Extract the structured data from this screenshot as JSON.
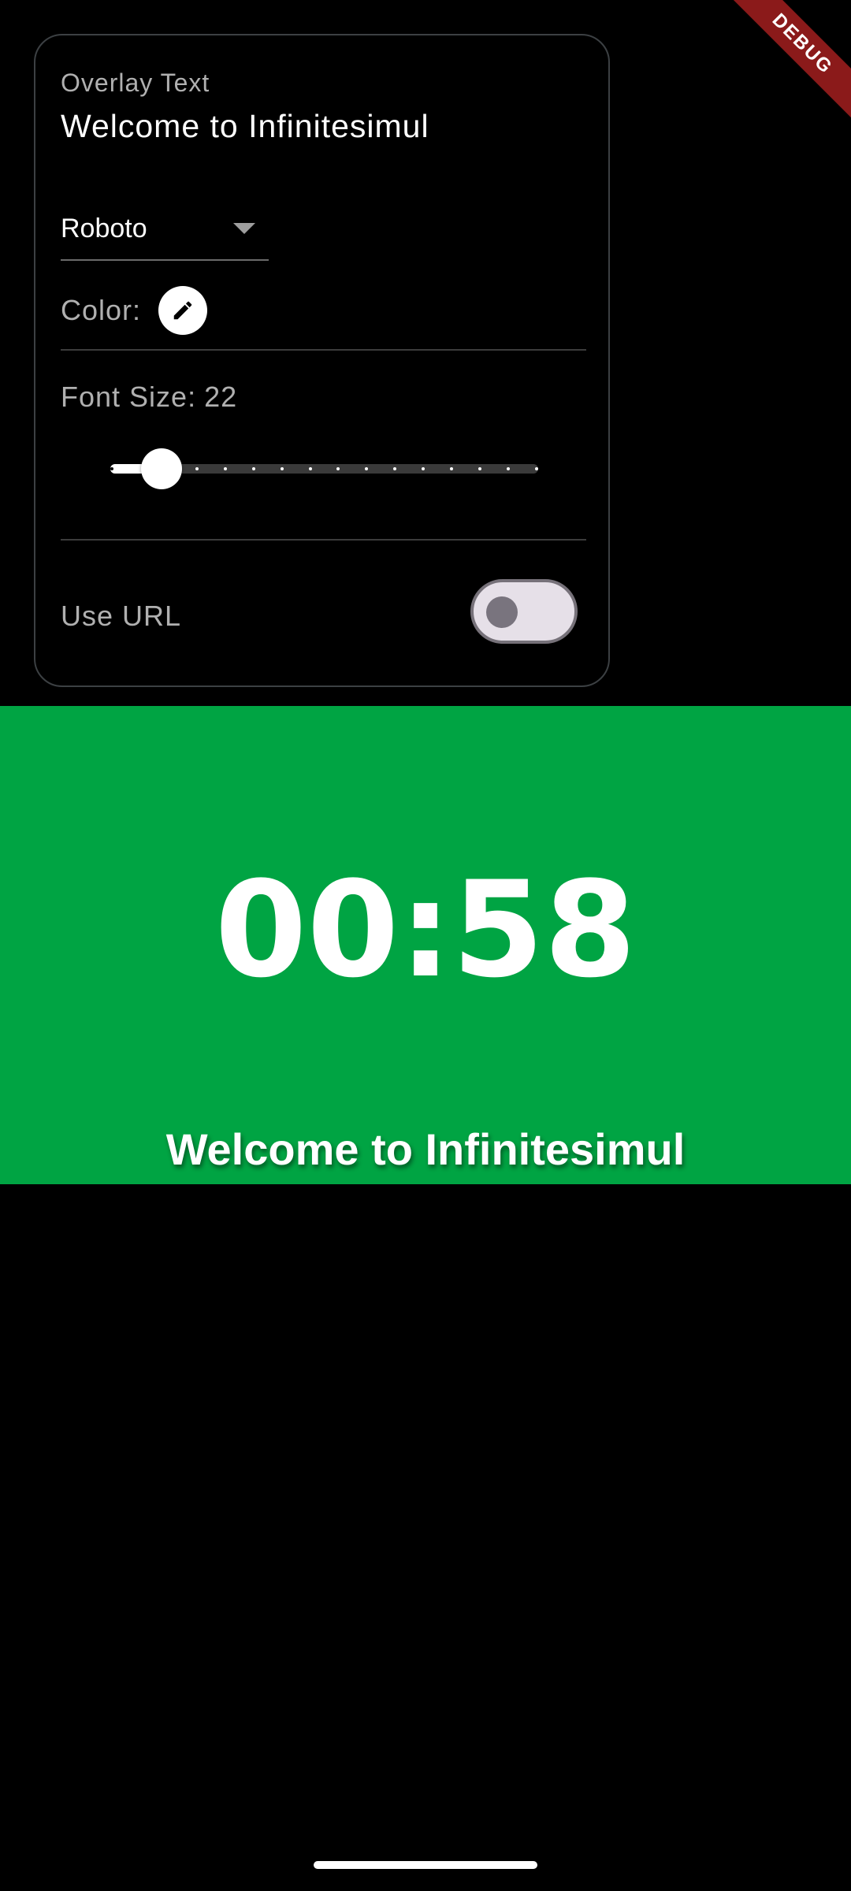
{
  "settings": {
    "overlay_text_label": "Overlay Text",
    "overlay_text_value": "Welcome to Infinitesimul",
    "font_dropdown": {
      "selected": "Roboto"
    },
    "color_label": "Color:",
    "color_button_icon": "pencil-icon",
    "font_size_label": "Font Size:",
    "font_size_value": "22",
    "slider": {
      "value_fraction": 0.12,
      "tick_count": 16
    },
    "use_url_label": "Use URL",
    "use_url_enabled": false
  },
  "preview": {
    "background_color": "#00a443",
    "timer": "00:58",
    "overlay_text": "Welcome to Infinitesimul"
  },
  "debug_banner": "DEBUG",
  "colors": {
    "background": "#000000",
    "preview_green": "#00a443",
    "banner_red": "#8b1a1a",
    "toggle_track": "#e6e0e8",
    "toggle_knob": "#79747e"
  }
}
